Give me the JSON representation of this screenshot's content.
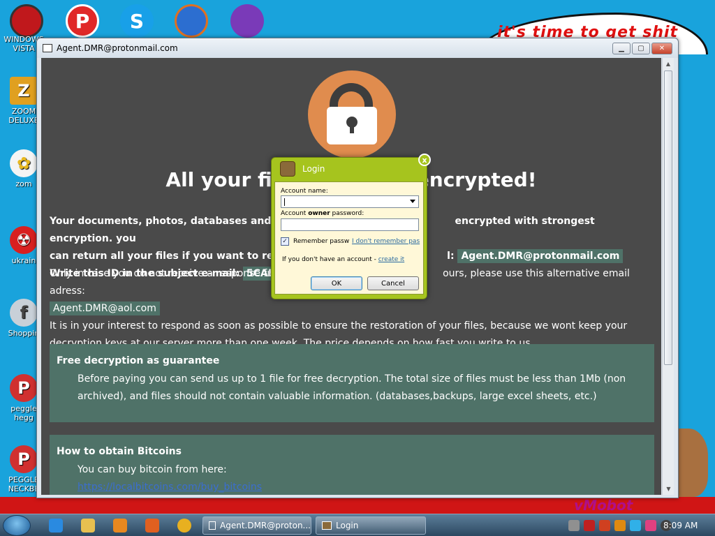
{
  "wallpaper": {
    "bubble_text": "it's time to get shit",
    "logo_text": "vMobot"
  },
  "desktop_icons": [
    {
      "label": "WINDOWS VISTA",
      "color": "#7a8a99",
      "icon": "pokeball-icon"
    },
    {
      "label": "ZOOM DELUXE",
      "color": "#e0a020",
      "icon": "zoom-icon"
    },
    {
      "label": "zom",
      "color": "#f0f0f0",
      "icon": "flower-icon"
    },
    {
      "label": "ukrain",
      "color": "#d82020",
      "icon": "radiation-icon"
    },
    {
      "label": "Shoppin",
      "color": "#c0c8d0",
      "icon": "flash-icon"
    },
    {
      "label": "peggle hegg",
      "color": "#d03030",
      "icon": "peggle-icon"
    },
    {
      "label": "PEGGLE NECKBE",
      "color": "#d03030",
      "icon": "peggle-icon"
    }
  ],
  "main_window": {
    "title": "Agent.DMR@protonmail.com",
    "headline_left": "All your fi",
    "headline_right": "encrypted!",
    "para1_line1_left": "Your documents, photos, databases and oth",
    "para1_line1_right": "encrypted with strongest encryption. you",
    "para1_line2_left": "can return all your files if you want to resto",
    "para1_line2_right": "l:",
    "email_main": "Agent.DMR@protonmail.com",
    "id_label": "Write this ID in the subject e-mail:",
    "id_value": "5CAE8B",
    "alt_line_left": "Only in case you do not receive a response from",
    "alt_line_right": "ours, please use this alternative email adress:",
    "email_alt": "Agent.DMR@aol.com",
    "interest_text": "It is in your interest to respond as soon as possible to ensure the restoration of your files, because we wont keep your decryption keys at our server more than one week. The price depends on how fast you write to us.",
    "free_title": "Free decryption as guarantee",
    "free_text": "Before paying you can send us up to 1 file for free decryption. The total size of files must be less than 1Mb (non archived), and files should not contain valuable information. (databases,backups, large excel sheets, etc.)",
    "bitcoin_title": "How to obtain Bitcoins",
    "bitcoin_text": "You can buy bitcoin from here:",
    "bitcoin_link": "https://localbitcoins.com/buy_bitcoins"
  },
  "login_dialog": {
    "title": "Login",
    "close": "x",
    "account_name_label": "Account name:",
    "password_label_pre": "Account ",
    "password_label_bold": "owner",
    "password_label_post": " password:",
    "remember_label": "Remember passw",
    "forgot_link": "I don't remember pas",
    "no_account_text": "If you don't have an account -",
    "create_link": "create it",
    "ok_label": "OK",
    "cancel_label": "Cancel"
  },
  "taskbar": {
    "tasks": [
      {
        "label": "Agent.DMR@proton..."
      },
      {
        "label": "Login"
      }
    ],
    "clock": "8:09 AM"
  }
}
